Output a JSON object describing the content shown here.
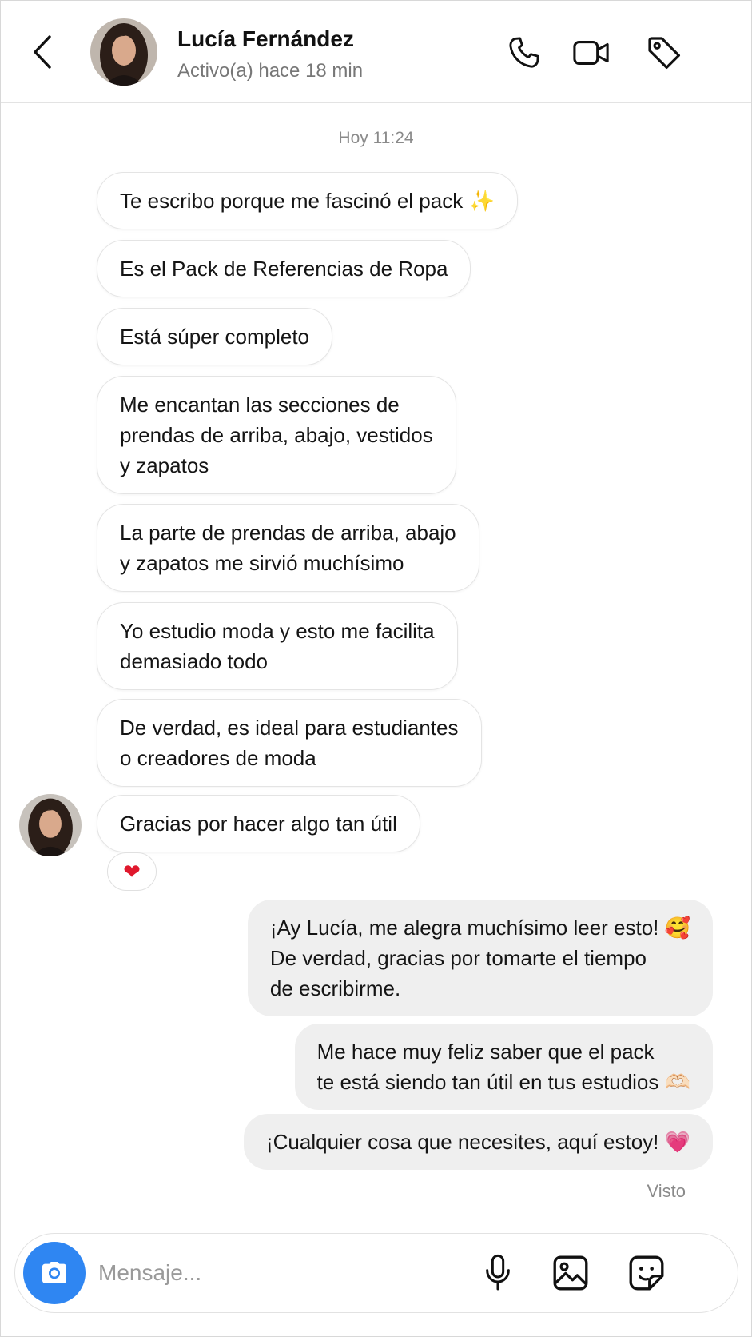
{
  "header": {
    "contact_name": "Lucía Fernández",
    "status": "Activo(a) hace 18 min",
    "icons": [
      "back-icon",
      "phone-icon",
      "video-camera-icon",
      "tag-icon"
    ]
  },
  "conversation": {
    "timestamp": "Hoy 11:24",
    "incoming": [
      "Te escribo porque me fascinó el pack ✨",
      "Es el Pack de Referencias de Ropa",
      "Está súper completo",
      "Me encantan las secciones de\nprendas de arriba, abajo, vestidos\ny zapatos",
      "La parte de prendas de arriba, abajo\ny zapatos me sirvió muchísimo",
      "Yo estudio moda y esto me facilita\ndemasiado todo",
      "De verdad, es ideal para estudiantes\no creadores de moda",
      "Gracias por hacer algo tan útil"
    ],
    "reaction": "❤",
    "outgoing": [
      "¡Ay Lucía, me alegra muchísimo leer esto! 🥰\nDe verdad, gracias por tomarte el tiempo\nde escribirme.",
      "Me hace muy feliz saber que el pack\nte está siendo tan útil en tus estudios 🫶🏻",
      "¡Cualquier cosa que necesites, aquí estoy! 💗"
    ],
    "seen_label": "Visto"
  },
  "composer": {
    "placeholder": "Mensaje...",
    "icons": [
      "camera-icon",
      "microphone-icon",
      "image-icon",
      "sticker-icon"
    ]
  },
  "colors": {
    "accent": "#2f86f2",
    "outgoing_bubble": "#efefef",
    "incoming_border": "#e4e4e4",
    "secondary_text": "#777777"
  }
}
